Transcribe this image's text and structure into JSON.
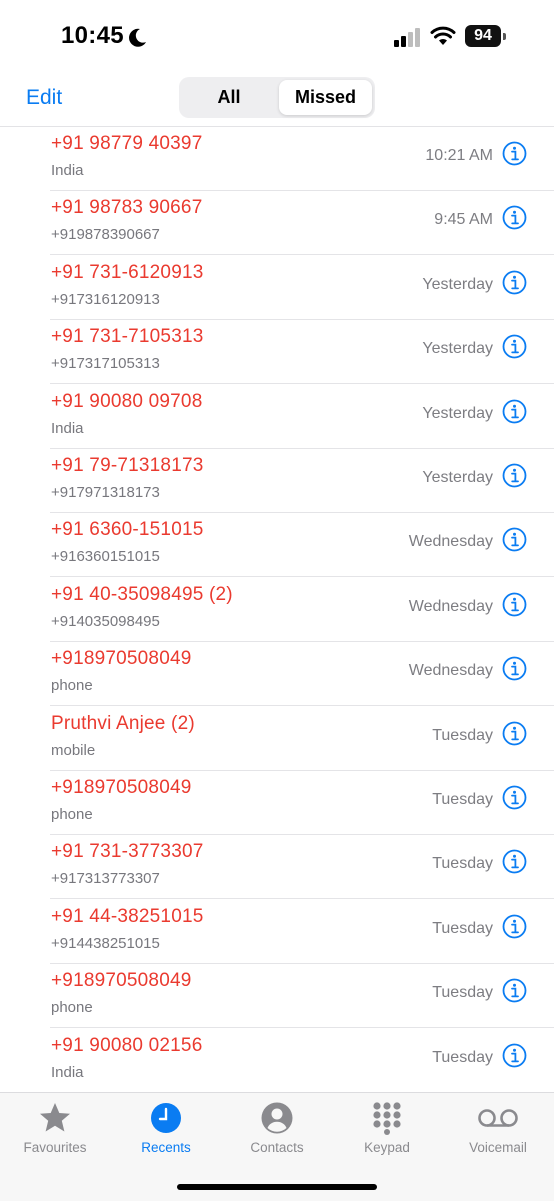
{
  "status_bar": {
    "time": "10:45",
    "battery": "94"
  },
  "nav": {
    "edit_label": "Edit",
    "segments": [
      "All",
      "Missed"
    ],
    "selected_segment": "Missed"
  },
  "colors": {
    "accent": "#0a7cf2",
    "missed": "#ea3a2f",
    "secondary": "#7d7d82"
  },
  "calls": [
    {
      "name": "+91 98779 40397",
      "detail": "India",
      "time": "10:21 AM"
    },
    {
      "name": "+91 98783 90667",
      "detail": "+919878390667",
      "time": "9:45 AM"
    },
    {
      "name": "+91 731-6120913",
      "detail": "+917316120913",
      "time": "Yesterday"
    },
    {
      "name": "+91 731-7105313",
      "detail": "+917317105313",
      "time": "Yesterday"
    },
    {
      "name": "+91 90080 09708",
      "detail": "India",
      "time": "Yesterday"
    },
    {
      "name": "+91 79-71318173",
      "detail": "+917971318173",
      "time": "Yesterday"
    },
    {
      "name": "+91 6360-151015",
      "detail": "+916360151015",
      "time": "Wednesday"
    },
    {
      "name": "+91 40-35098495 (2)",
      "detail": "+914035098495",
      "time": "Wednesday"
    },
    {
      "name": "+918970508049",
      "detail": "phone",
      "time": "Wednesday"
    },
    {
      "name": "Pruthvi Anjee (2)",
      "detail": "mobile",
      "time": "Tuesday"
    },
    {
      "name": "+918970508049",
      "detail": "phone",
      "time": "Tuesday"
    },
    {
      "name": "+91 731-3773307",
      "detail": "+917313773307",
      "time": "Tuesday"
    },
    {
      "name": "+91 44-38251015",
      "detail": "+914438251015",
      "time": "Tuesday"
    },
    {
      "name": "+918970508049",
      "detail": "phone",
      "time": "Tuesday"
    },
    {
      "name": "+91 90080 02156",
      "detail": "India",
      "time": "Tuesday"
    }
  ],
  "tabs": [
    {
      "label": "Favourites",
      "icon": "star-icon"
    },
    {
      "label": "Recents",
      "icon": "clock-icon"
    },
    {
      "label": "Contacts",
      "icon": "person-icon"
    },
    {
      "label": "Keypad",
      "icon": "keypad-icon"
    },
    {
      "label": "Voicemail",
      "icon": "voicemail-icon"
    }
  ],
  "active_tab": "Recents"
}
